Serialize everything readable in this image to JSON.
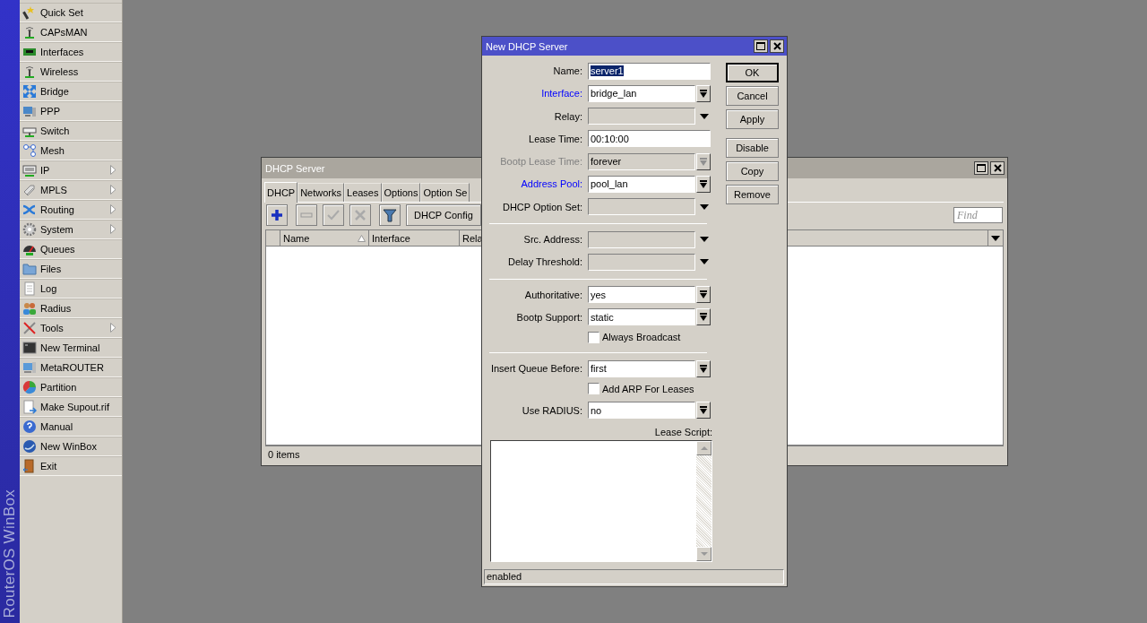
{
  "sidebar": {
    "brand": "RouterOS WinBox",
    "items": [
      {
        "label": "Quick Set",
        "submenu": false
      },
      {
        "label": "CAPsMAN",
        "submenu": false
      },
      {
        "label": "Interfaces",
        "submenu": false
      },
      {
        "label": "Wireless",
        "submenu": false
      },
      {
        "label": "Bridge",
        "submenu": false
      },
      {
        "label": "PPP",
        "submenu": false
      },
      {
        "label": "Switch",
        "submenu": false
      },
      {
        "label": "Mesh",
        "submenu": false
      },
      {
        "label": "IP",
        "submenu": true
      },
      {
        "label": "MPLS",
        "submenu": true
      },
      {
        "label": "Routing",
        "submenu": true
      },
      {
        "label": "System",
        "submenu": true
      },
      {
        "label": "Queues",
        "submenu": false
      },
      {
        "label": "Files",
        "submenu": false
      },
      {
        "label": "Log",
        "submenu": false
      },
      {
        "label": "Radius",
        "submenu": false
      },
      {
        "label": "Tools",
        "submenu": true
      },
      {
        "label": "New Terminal",
        "submenu": false
      },
      {
        "label": "MetaROUTER",
        "submenu": false
      },
      {
        "label": "Partition",
        "submenu": false
      },
      {
        "label": "Make Supout.rif",
        "submenu": false
      },
      {
        "label": "Manual",
        "submenu": false
      },
      {
        "label": "New WinBox",
        "submenu": false
      },
      {
        "label": "Exit",
        "submenu": false
      }
    ]
  },
  "server_window": {
    "title": "DHCP Server",
    "tabs": [
      {
        "label": "DHCP",
        "selected": true
      },
      {
        "label": "Networks",
        "selected": false
      },
      {
        "label": "Leases",
        "selected": false
      },
      {
        "label": "Options",
        "selected": false
      },
      {
        "label": "Option Se",
        "selected": false
      }
    ],
    "toolbar": {
      "icon_buttons": [
        {
          "disabled": false
        },
        {
          "disabled": true
        },
        {
          "disabled": true
        },
        {
          "disabled": true
        },
        {
          "disabled": false
        }
      ],
      "text_button": "DHCP Config"
    },
    "find": {
      "placeholder": "Find"
    },
    "table": {
      "columns": [
        {
          "label": "Name",
          "sorted": true
        },
        {
          "label": "Interface",
          "sorted": false
        },
        {
          "label": "Rela",
          "sorted": false
        }
      ]
    },
    "status_bar": "0 items"
  },
  "dialog": {
    "title": "New DHCP Server",
    "rows": [
      {
        "kind": "text",
        "label": "Name:",
        "value": "server1",
        "highlighted": true,
        "link": false,
        "disabled": false
      },
      {
        "kind": "select",
        "label": "Interface:",
        "value": "bridge_lan",
        "link": true,
        "disabled": false
      },
      {
        "kind": "unset",
        "label": "Relay:",
        "link": false,
        "disabled": false
      },
      {
        "kind": "text",
        "label": "Lease Time:",
        "value": "00:10:00",
        "highlighted": false,
        "link": false,
        "disabled": false
      },
      {
        "kind": "select",
        "label": "Bootp Lease Time:",
        "value": "forever",
        "link": false,
        "disabled": true
      },
      {
        "kind": "select",
        "label": "Address Pool:",
        "value": "pool_lan",
        "link": true,
        "disabled": false
      },
      {
        "kind": "unset",
        "label": "DHCP Option Set:",
        "link": false,
        "disabled": false
      },
      {
        "kind": "separator"
      },
      {
        "kind": "unset",
        "label": "Src. Address:",
        "link": false,
        "disabled": false
      },
      {
        "kind": "unset",
        "label": "Delay Threshold:",
        "link": false,
        "disabled": false
      },
      {
        "kind": "separator"
      },
      {
        "kind": "select",
        "label": "Authoritative:",
        "value": "yes",
        "link": false,
        "disabled": false
      },
      {
        "kind": "select",
        "label": "Bootp Support:",
        "value": "static",
        "link": false,
        "disabled": false
      },
      {
        "kind": "checkbox",
        "label": "Always Broadcast",
        "checked": false
      },
      {
        "kind": "separator"
      },
      {
        "kind": "select",
        "label": "Insert Queue Before:",
        "value": "first",
        "link": false,
        "disabled": false
      },
      {
        "kind": "checkbox",
        "label": "Add ARP For Leases",
        "checked": false
      },
      {
        "kind": "select",
        "label": "Use RADIUS:",
        "value": "no",
        "link": false,
        "disabled": false
      }
    ],
    "script_label": "Lease Script:",
    "button_groups": [
      [
        {
          "label": "OK",
          "default": true
        },
        {
          "label": "Cancel",
          "default": false
        },
        {
          "label": "Apply",
          "default": false
        }
      ],
      [
        {
          "label": "Disable",
          "default": false
        },
        {
          "label": "Copy",
          "default": false
        },
        {
          "label": "Remove",
          "default": false
        }
      ]
    ],
    "status_bar": "enabled"
  }
}
